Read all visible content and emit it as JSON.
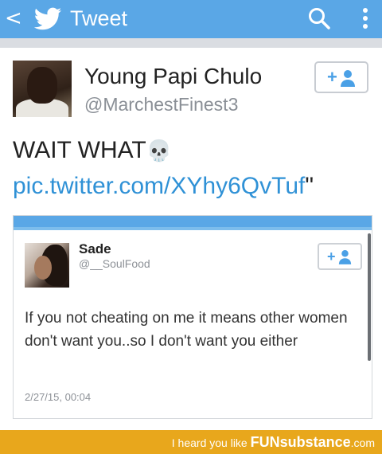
{
  "header": {
    "back_glyph": "<",
    "title": "Tweet",
    "icons": [
      "back-icon",
      "twitter-bird-icon",
      "search-icon",
      "more-vertical-icon"
    ]
  },
  "tweet": {
    "name": "Young Papi Chulo",
    "handle": "@MarchestFinest3",
    "follow_plus": "+",
    "text_before": "WAIT WHAT",
    "emoji": "💀",
    "link": "pic.twitter.com/XYhy6QvTuf",
    "text_after": "\""
  },
  "embedded": {
    "name": "Sade",
    "handle": "@__SoulFood",
    "follow_plus": "+",
    "text": "If you not cheating on me it means other women don't want you..so I don't want you either",
    "timestamp": "2/27/15, 00:04"
  },
  "footer": {
    "text": "I heard you like",
    "brand_bold": "FUN",
    "brand_rest": "substance",
    "domain": ".com"
  },
  "colors": {
    "header_blue": "#5aa7e6",
    "link_blue": "#2f91d6",
    "footer_orange": "#e8a71c"
  }
}
